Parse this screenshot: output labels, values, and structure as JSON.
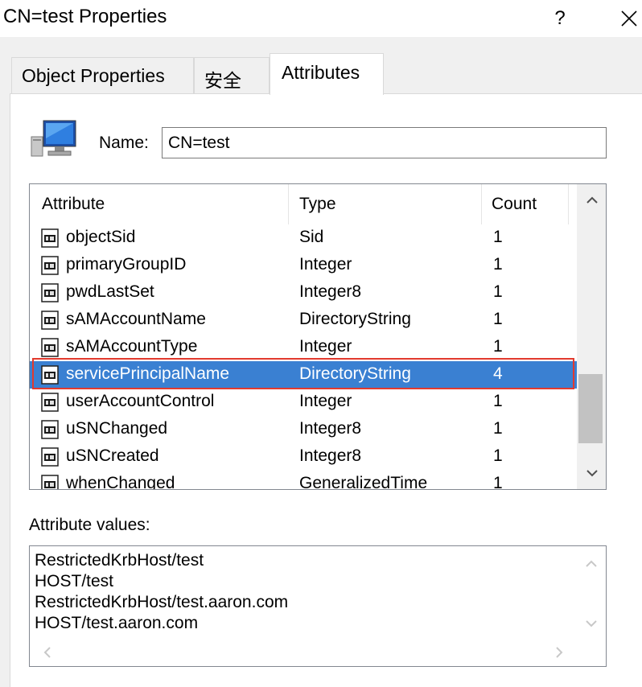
{
  "window": {
    "title": "CN=test Properties",
    "help_label": "?"
  },
  "tabs": [
    {
      "label": "Object Properties",
      "active": false
    },
    {
      "label": "安全",
      "active": false
    },
    {
      "label": "Attributes",
      "active": true
    }
  ],
  "name_label": "Name:",
  "name_value": "CN=test",
  "attributes_table": {
    "columns": [
      "Attribute",
      "Type",
      "Count"
    ],
    "rows": [
      {
        "attribute": "objectSid",
        "type": "Sid",
        "count": "1"
      },
      {
        "attribute": "primaryGroupID",
        "type": "Integer",
        "count": "1"
      },
      {
        "attribute": "pwdLastSet",
        "type": "Integer8",
        "count": "1"
      },
      {
        "attribute": "sAMAccountName",
        "type": "DirectoryString",
        "count": "1"
      },
      {
        "attribute": "sAMAccountType",
        "type": "Integer",
        "count": "1"
      },
      {
        "attribute": "servicePrincipalName",
        "type": "DirectoryString",
        "count": "4",
        "selected": true
      },
      {
        "attribute": "userAccountControl",
        "type": "Integer",
        "count": "1"
      },
      {
        "attribute": "uSNChanged",
        "type": "Integer8",
        "count": "1"
      },
      {
        "attribute": "uSNCreated",
        "type": "Integer8",
        "count": "1"
      },
      {
        "attribute": "whenChanged",
        "type": "GeneralizedTime",
        "count": "1"
      }
    ]
  },
  "values_label": "Attribute values:",
  "attribute_values": [
    "RestrictedKrbHost/test",
    "HOST/test",
    "RestrictedKrbHost/test.aaron.com",
    "HOST/test.aaron.com"
  ],
  "colors": {
    "selection": "#3a80d2",
    "highlight_outline": "#e23a2e"
  }
}
